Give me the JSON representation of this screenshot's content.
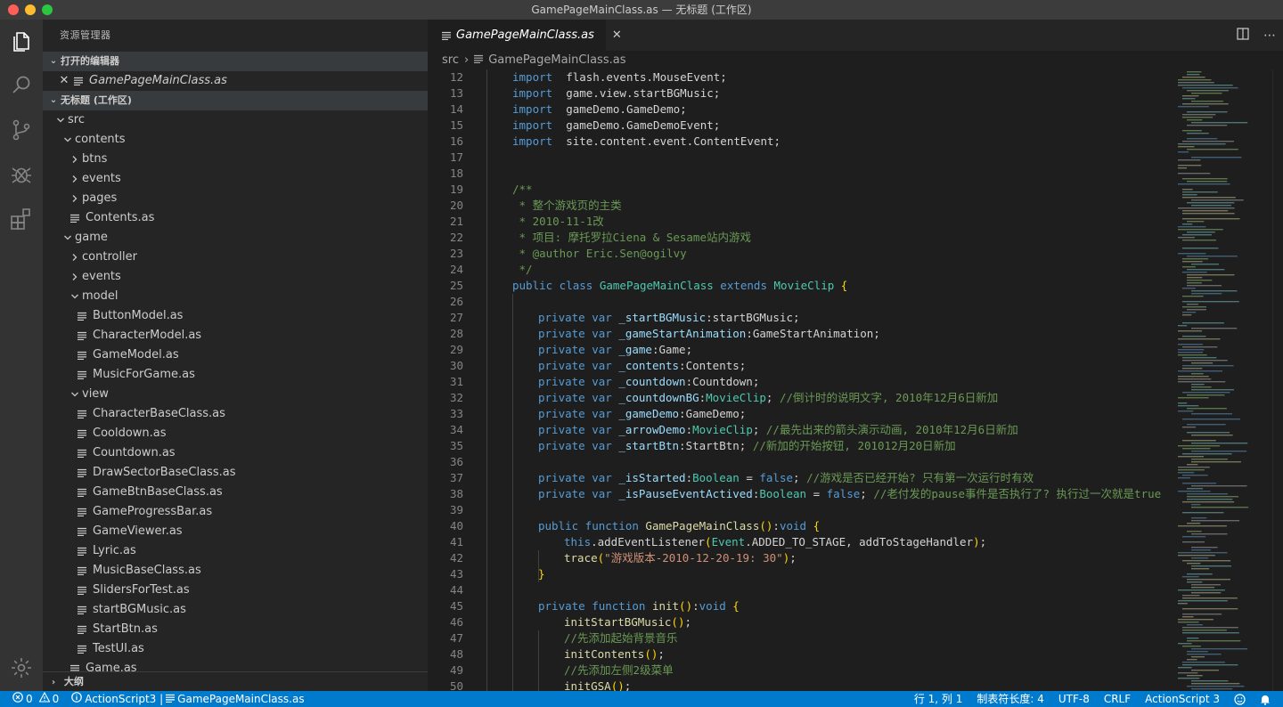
{
  "window": {
    "title": "GamePageMainClass.as — 无标题 (工作区)"
  },
  "colors": {
    "accent": "#007acc",
    "editor_bg": "#1e1e1e",
    "sidebar_bg": "#252526",
    "activity_bg": "#333333"
  },
  "activitybar": {
    "icons": [
      "files-icon",
      "search-icon",
      "source-control-icon",
      "debug-icon",
      "extensions-icon",
      "gear-icon"
    ]
  },
  "sidebar": {
    "title": "资源管理器",
    "open_editors_label": "打开的编辑器",
    "open_editors": [
      {
        "name": "GamePageMainClass.as"
      }
    ],
    "workspace_label": "无标题 (工作区)",
    "tree": [
      {
        "name": "src",
        "type": "folder",
        "depth": 0,
        "open": true
      },
      {
        "name": "contents",
        "type": "folder",
        "depth": 1,
        "open": true
      },
      {
        "name": "btns",
        "type": "folder",
        "depth": 2,
        "open": false
      },
      {
        "name": "events",
        "type": "folder",
        "depth": 2,
        "open": false
      },
      {
        "name": "pages",
        "type": "folder",
        "depth": 2,
        "open": false
      },
      {
        "name": "Contents.as",
        "type": "file",
        "depth": 2
      },
      {
        "name": "game",
        "type": "folder",
        "depth": 1,
        "open": true
      },
      {
        "name": "controller",
        "type": "folder",
        "depth": 2,
        "open": false
      },
      {
        "name": "events",
        "type": "folder",
        "depth": 2,
        "open": false
      },
      {
        "name": "model",
        "type": "folder",
        "depth": 2,
        "open": true
      },
      {
        "name": "ButtonModel.as",
        "type": "file",
        "depth": 3
      },
      {
        "name": "CharacterModel.as",
        "type": "file",
        "depth": 3
      },
      {
        "name": "GameModel.as",
        "type": "file",
        "depth": 3
      },
      {
        "name": "MusicForGame.as",
        "type": "file",
        "depth": 3
      },
      {
        "name": "view",
        "type": "folder",
        "depth": 2,
        "open": true
      },
      {
        "name": "CharacterBaseClass.as",
        "type": "file",
        "depth": 3
      },
      {
        "name": "Cooldown.as",
        "type": "file",
        "depth": 3
      },
      {
        "name": "Countdown.as",
        "type": "file",
        "depth": 3
      },
      {
        "name": "DrawSectorBaseClass.as",
        "type": "file",
        "depth": 3
      },
      {
        "name": "GameBtnBaseClass.as",
        "type": "file",
        "depth": 3
      },
      {
        "name": "GameProgressBar.as",
        "type": "file",
        "depth": 3
      },
      {
        "name": "GameViewer.as",
        "type": "file",
        "depth": 3
      },
      {
        "name": "Lyric.as",
        "type": "file",
        "depth": 3
      },
      {
        "name": "MusicBaseClass.as",
        "type": "file",
        "depth": 3
      },
      {
        "name": "SlidersForTest.as",
        "type": "file",
        "depth": 3
      },
      {
        "name": "startBGMusic.as",
        "type": "file",
        "depth": 3
      },
      {
        "name": "StartBtn.as",
        "type": "file",
        "depth": 3
      },
      {
        "name": "TestUI.as",
        "type": "file",
        "depth": 3
      },
      {
        "name": "Game.as",
        "type": "file",
        "depth": 2
      }
    ],
    "outline_label": "大纲"
  },
  "editor": {
    "tab_label": "GamePageMainClass.as",
    "breadcrumb": [
      "src",
      "GamePageMainClass.as"
    ],
    "lines": [
      {
        "n": "12",
        "t": [
          [
            "kw",
            "import"
          ],
          [
            "",
            "  flash.events.MouseEvent;"
          ]
        ],
        "i": 1
      },
      {
        "n": "13",
        "t": [
          [
            "kw",
            "import"
          ],
          [
            "",
            "  game.view.startBGMusic;"
          ]
        ],
        "i": 1
      },
      {
        "n": "14",
        "t": [
          [
            "kw",
            "import"
          ],
          [
            "",
            "  gameDemo.GameDemo;"
          ]
        ],
        "i": 1
      },
      {
        "n": "15",
        "t": [
          [
            "kw",
            "import"
          ],
          [
            "",
            "  gameDemo.GameDemoEvent;"
          ]
        ],
        "i": 1
      },
      {
        "n": "16",
        "t": [
          [
            "kw",
            "import"
          ],
          [
            "",
            "  site.content.event.ContentEvent;"
          ]
        ],
        "i": 1
      },
      {
        "n": "17",
        "t": [],
        "i": 0
      },
      {
        "n": "18",
        "t": [],
        "i": 0
      },
      {
        "n": "19",
        "t": [
          [
            "cm",
            "/**"
          ]
        ],
        "i": 1
      },
      {
        "n": "20",
        "t": [
          [
            "cm",
            " * 整个游戏页的主类"
          ]
        ],
        "i": 1
      },
      {
        "n": "21",
        "t": [
          [
            "cm",
            " * 2010-11-1改"
          ]
        ],
        "i": 1
      },
      {
        "n": "22",
        "t": [
          [
            "cm",
            " * 项目: 摩托罗拉Ciena & Sesame站内游戏"
          ]
        ],
        "i": 1
      },
      {
        "n": "23",
        "t": [
          [
            "cm",
            " * @author Eric.Sen@ogilvy"
          ]
        ],
        "i": 1
      },
      {
        "n": "24",
        "t": [
          [
            "cm",
            " */"
          ]
        ],
        "i": 1
      },
      {
        "n": "25",
        "t": [
          [
            "kw",
            "public class "
          ],
          [
            "ty",
            "GamePageMainClass"
          ],
          [
            "kw",
            " extends "
          ],
          [
            "ty",
            "MovieClip"
          ],
          [
            "br",
            " {"
          ]
        ],
        "i": 1
      },
      {
        "n": "26",
        "t": [],
        "i": 0
      },
      {
        "n": "27",
        "t": [
          [
            "kw",
            "private var "
          ],
          [
            "va",
            "_startBGMusic"
          ],
          [
            "",
            ":startBGMusic;"
          ]
        ],
        "i": 2
      },
      {
        "n": "28",
        "t": [
          [
            "kw",
            "private var "
          ],
          [
            "va",
            "_gameStartAnimation"
          ],
          [
            "",
            ":GameStartAnimation;"
          ]
        ],
        "i": 2
      },
      {
        "n": "29",
        "t": [
          [
            "kw",
            "private var "
          ],
          [
            "va",
            "_game"
          ],
          [
            "",
            ":Game;"
          ]
        ],
        "i": 2
      },
      {
        "n": "30",
        "t": [
          [
            "kw",
            "private var "
          ],
          [
            "va",
            "_contents"
          ],
          [
            "",
            ":Contents;"
          ]
        ],
        "i": 2
      },
      {
        "n": "31",
        "t": [
          [
            "kw",
            "private var "
          ],
          [
            "va",
            "_countdown"
          ],
          [
            "",
            ":Countdown;"
          ]
        ],
        "i": 2
      },
      {
        "n": "32",
        "t": [
          [
            "kw",
            "private var "
          ],
          [
            "va",
            "_countdownBG"
          ],
          [
            "",
            ":"
          ],
          [
            "ty",
            "MovieClip"
          ],
          [
            "",
            "; "
          ],
          [
            "cm",
            "//倒计时的说明文字, 2010年12月6日新加"
          ]
        ],
        "i": 2
      },
      {
        "n": "33",
        "t": [
          [
            "kw",
            "private var "
          ],
          [
            "va",
            "_gameDemo"
          ],
          [
            "",
            ":GameDemo;"
          ]
        ],
        "i": 2
      },
      {
        "n": "34",
        "t": [
          [
            "kw",
            "private var "
          ],
          [
            "va",
            "_arrowDemo"
          ],
          [
            "",
            ":"
          ],
          [
            "ty",
            "MovieClip"
          ],
          [
            "",
            "; "
          ],
          [
            "cm",
            "//最先出来的箭头演示动画, 2010年12月6日新加"
          ]
        ],
        "i": 2
      },
      {
        "n": "35",
        "t": [
          [
            "kw",
            "private var "
          ],
          [
            "va",
            "_startBtn"
          ],
          [
            "",
            ":StartBtn; "
          ],
          [
            "cm",
            "//新加的开始按钮, 201012月20日新加"
          ]
        ],
        "i": 2
      },
      {
        "n": "36",
        "t": [],
        "i": 0
      },
      {
        "n": "37",
        "t": [
          [
            "kw",
            "private var "
          ],
          [
            "va",
            "_isStarted"
          ],
          [
            "",
            ":"
          ],
          [
            "ty",
            "Boolean"
          ],
          [
            "",
            " = "
          ],
          [
            "kw",
            "false"
          ],
          [
            "",
            "; "
          ],
          [
            "cm",
            "//游戏是否已经开始? 只有第一次运行时有效"
          ]
        ],
        "i": 2
      },
      {
        "n": "38",
        "t": [
          [
            "kw",
            "private var "
          ],
          [
            "va",
            "_isPauseEventActived"
          ],
          [
            "",
            ":"
          ],
          [
            "ty",
            "Boolean"
          ],
          [
            "",
            " = "
          ],
          [
            "kw",
            "false"
          ],
          [
            "",
            "; "
          ],
          [
            "cm",
            "//老付发的pause事件是否执行了? 执行过一次就是true"
          ]
        ],
        "i": 2
      },
      {
        "n": "39",
        "t": [],
        "i": 0
      },
      {
        "n": "40",
        "t": [
          [
            "kw",
            "public function "
          ],
          [
            "fn",
            "GamePageMainClass"
          ],
          [
            "br",
            "()"
          ],
          [
            "",
            ":"
          ],
          [
            "kw",
            "void"
          ],
          [
            "br",
            " {"
          ]
        ],
        "i": 2
      },
      {
        "n": "41",
        "t": [
          [
            "kw",
            "this"
          ],
          [
            "",
            ".addEventListener"
          ],
          [
            "br",
            "("
          ],
          [
            "ty",
            "Event"
          ],
          [
            "",
            ".ADDED_TO_STAGE, addToStageHandler"
          ],
          [
            "br",
            ")"
          ],
          [
            "",
            ";"
          ]
        ],
        "i": 3
      },
      {
        "n": "42",
        "t": [
          [
            "fn",
            "trace"
          ],
          [
            "br",
            "("
          ],
          [
            "st",
            "\"游戏版本-2010-12-20-19: 30\""
          ],
          [
            "br",
            ")"
          ],
          [
            "",
            ";"
          ]
        ],
        "i": 3
      },
      {
        "n": "43",
        "t": [
          [
            "br",
            "}"
          ]
        ],
        "i": 2
      },
      {
        "n": "44",
        "t": [],
        "i": 0
      },
      {
        "n": "45",
        "t": [
          [
            "kw",
            "private function "
          ],
          [
            "fn",
            "init"
          ],
          [
            "br",
            "()"
          ],
          [
            "",
            ":"
          ],
          [
            "kw",
            "void"
          ],
          [
            "br",
            " {"
          ]
        ],
        "i": 2
      },
      {
        "n": "46",
        "t": [
          [
            "fn",
            "initStartBGMusic"
          ],
          [
            "br",
            "()"
          ],
          [
            "",
            ";"
          ]
        ],
        "i": 3
      },
      {
        "n": "47",
        "t": [
          [
            "cm",
            "//先添加起始背景音乐"
          ]
        ],
        "i": 3
      },
      {
        "n": "48",
        "t": [
          [
            "fn",
            "initContents"
          ],
          [
            "br",
            "()"
          ],
          [
            "",
            ";"
          ]
        ],
        "i": 3
      },
      {
        "n": "49",
        "t": [
          [
            "cm",
            "//先添加左侧2级菜单"
          ]
        ],
        "i": 3
      },
      {
        "n": "50",
        "t": [
          [
            "fn",
            "initGSA"
          ],
          [
            "br",
            "()"
          ],
          [
            "",
            ";"
          ]
        ],
        "i": 3
      }
    ]
  },
  "statusbar": {
    "errors": "0",
    "warnings": "0",
    "language_info": "ActionScript3 | ",
    "file_info": "GamePageMainClass.as",
    "position": "行 1, 列 1",
    "tab_size": "制表符长度: 4",
    "encoding": "UTF-8",
    "eol": "CRLF",
    "language": "ActionScript 3"
  }
}
